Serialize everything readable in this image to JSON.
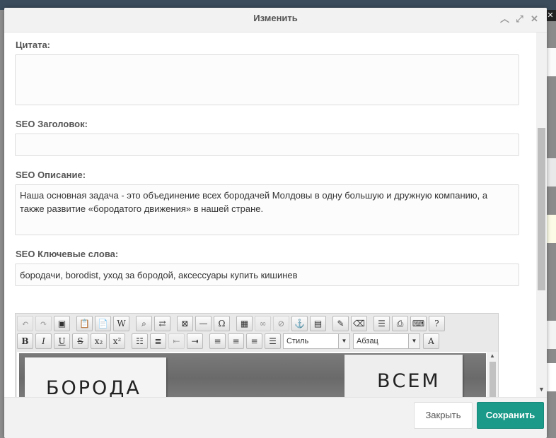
{
  "modal": {
    "title": "Изменить"
  },
  "fields": {
    "quote_label": "Цитата:",
    "quote_value": "",
    "seo_title_label": "SEO Заголовок:",
    "seo_title_value": "",
    "seo_description_label": "SEO Описание:",
    "seo_description_value": "Наша основная задача - это объединение всех бородачей Молдовы в одну большую и дружную компанию, а также развитие «бородатого движения» в нашей стране.",
    "seo_keywords_label": "SEO Ключевые слова:",
    "seo_keywords_value": "бородачи, borodist, уход за бородой, аксессуары купить кишинев"
  },
  "editor": {
    "style_select": "Стиль",
    "format_select": "Абзац",
    "image_sign_1": "БОРОДА",
    "image_sign_2": "ВСЕМ"
  },
  "footer": {
    "close_label": "Закрыть",
    "save_label": "Сохранить"
  },
  "colors": {
    "save_button": "#1b9a8a",
    "header_bg": "#f2f2f2"
  }
}
